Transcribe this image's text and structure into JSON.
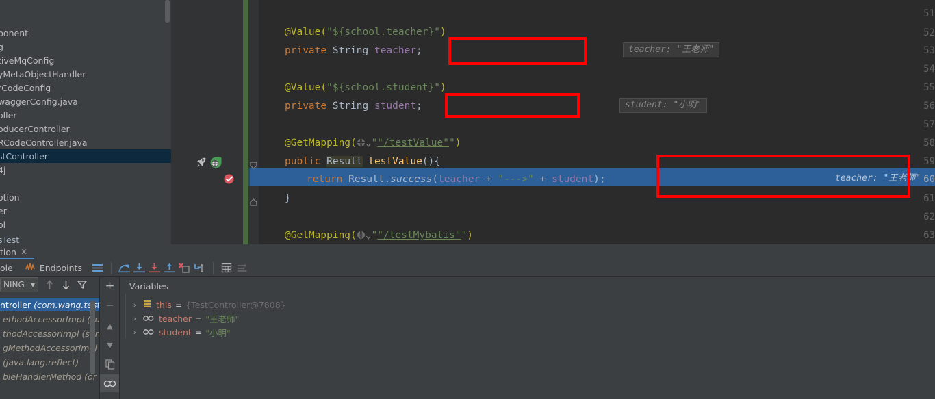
{
  "sidebar": {
    "items": [
      {
        "label": "ponent",
        "selected": false
      },
      {
        "label": "g",
        "selected": false
      },
      {
        "label": "tiveMqConfig",
        "selected": false
      },
      {
        "label": "yMetaObjectHandler",
        "selected": false
      },
      {
        "label": "rCodeConfig",
        "selected": false
      },
      {
        "label": "waggerConfig.java",
        "selected": false
      },
      {
        "label": "oller",
        "selected": false
      },
      {
        "label": "oducerController",
        "selected": false
      },
      {
        "label": "RCodeController.java",
        "selected": false
      },
      {
        "label": "stController",
        "selected": true
      },
      {
        "label": "4j",
        "selected": false
      },
      {
        "label": "",
        "selected": false
      },
      {
        "label": "otion",
        "selected": false
      },
      {
        "label": "er",
        "selected": false
      },
      {
        "label": "ol",
        "selected": false
      },
      {
        "label": "sTest",
        "selected": false
      }
    ]
  },
  "editor": {
    "lines": [
      {
        "num": "51",
        "current": false
      },
      {
        "num": "52",
        "current": false
      },
      {
        "num": "53",
        "current": false
      },
      {
        "num": "54",
        "current": false
      },
      {
        "num": "55",
        "current": false
      },
      {
        "num": "56",
        "current": false
      },
      {
        "num": "57",
        "current": false
      },
      {
        "num": "58",
        "current": false
      },
      {
        "num": "59",
        "current": false
      },
      {
        "num": "60",
        "current": true
      },
      {
        "num": "61",
        "current": false
      },
      {
        "num": "62",
        "current": false
      },
      {
        "num": "63",
        "current": false
      }
    ],
    "code": {
      "l52_anno": "@Value(",
      "l52_str": "\"${school.teacher}\"",
      "l52_close": ")",
      "l53_kw": "private",
      "l53_type": "String",
      "l53_field": "teacher",
      "l53_semi": ";",
      "l55_anno": "@Value(",
      "l55_str": "\"${school.student}\"",
      "l55_close": ")",
      "l56_kw": "private",
      "l56_type": "String",
      "l56_field": "student",
      "l56_semi": ";",
      "l58_anno": "@GetMapping(",
      "l58_path": "\"/testValue\"",
      "l58_close": ")",
      "l59_kw": "public",
      "l59_type": "Result",
      "l59_meth": "testValue",
      "l59_tail": "(){",
      "l60_kw": "return",
      "l60_cls": "Result.",
      "l60_meth": "success",
      "l60_open": "(",
      "l60_f1": "teacher",
      "l60_plus1": " + ",
      "l60_str": "\"--->\"",
      "l60_plus2": " + ",
      "l60_f2": "student",
      "l60_close": ");",
      "l61_brace": "}",
      "l63_anno": "@GetMapping(",
      "l63_path": "\"/testMybatis\"",
      "l63_close": ")"
    },
    "hints": {
      "teacher_field": "teacher: \"王老师\"",
      "student_field": "student: \"小明\"",
      "exec_line": "teacher: \"王老师\"    student: \"小明\""
    },
    "gutter_icons": {
      "run_rocket": "rocket-icon",
      "run_globe": "globe-run-icon",
      "breakpoint": "breakpoint-verified-icon"
    },
    "annotation_color": "#ff0000"
  },
  "debug_panel": {
    "tab": {
      "label": "tion",
      "close": "✕"
    },
    "toolbar": {
      "console_label": "ole",
      "endpoints_label": "Endpoints",
      "buttons": [
        {
          "name": "show-as-tree",
          "glyph": "≡"
        },
        {
          "name": "step-over",
          "glyph": "step-over-icon"
        },
        {
          "name": "step-into",
          "glyph": "step-into-icon"
        },
        {
          "name": "force-step-into",
          "glyph": "force-step-into-icon"
        },
        {
          "name": "step-out",
          "glyph": "step-out-icon"
        },
        {
          "name": "drop-frame",
          "glyph": "drop-frame-icon"
        },
        {
          "name": "run-to-cursor",
          "glyph": "run-to-cursor-icon"
        },
        {
          "name": "evaluate-expression",
          "glyph": "evaluate-icon"
        },
        {
          "name": "settings",
          "glyph": "settings-icon"
        }
      ]
    },
    "frames": {
      "thread_label": "NING",
      "toolbar": [
        {
          "name": "frames-up",
          "glyph": "↑"
        },
        {
          "name": "frames-down",
          "glyph": "↓"
        },
        {
          "name": "frames-filter",
          "glyph": "filter-icon"
        }
      ],
      "side_buttons": [
        {
          "name": "add-watch",
          "glyph": "+"
        },
        {
          "name": "remove-watch",
          "glyph": "−"
        },
        {
          "name": "move-up",
          "glyph": "▲"
        },
        {
          "name": "move-down",
          "glyph": "▼"
        },
        {
          "name": "copy-value",
          "glyph": "copy-icon"
        },
        {
          "name": "watches-toggle",
          "glyph": "watches-icon"
        }
      ],
      "rows": [
        {
          "name": "ntroller",
          "pkg": "(com.wang.test.c",
          "selected": true
        },
        {
          "name": "",
          "pkg": "ethodAccessorImpl (sun.",
          "selected": false
        },
        {
          "name": "",
          "pkg": "thodAccessorImpl (sun.r",
          "selected": false
        },
        {
          "name": "",
          "pkg": "gMethodAccessorImpl (s",
          "selected": false
        },
        {
          "name": "",
          "pkg": "(java.lang.reflect)",
          "selected": false
        },
        {
          "name": "",
          "pkg": "bleHandlerMethod (or",
          "selected": false
        }
      ]
    },
    "variables": {
      "title": "Variables",
      "rows": [
        {
          "arrow": "›",
          "icon": "object-icon",
          "name": "this",
          "eq": "=",
          "value": "{TestController@7808}",
          "kind": "obj"
        },
        {
          "arrow": "›",
          "icon": "field-icon",
          "name": "teacher",
          "eq": "=",
          "value": "\"王老师\"",
          "kind": "str"
        },
        {
          "arrow": "›",
          "icon": "field-icon",
          "name": "student",
          "eq": "=",
          "value": "\"小明\"",
          "kind": "str"
        }
      ]
    }
  }
}
